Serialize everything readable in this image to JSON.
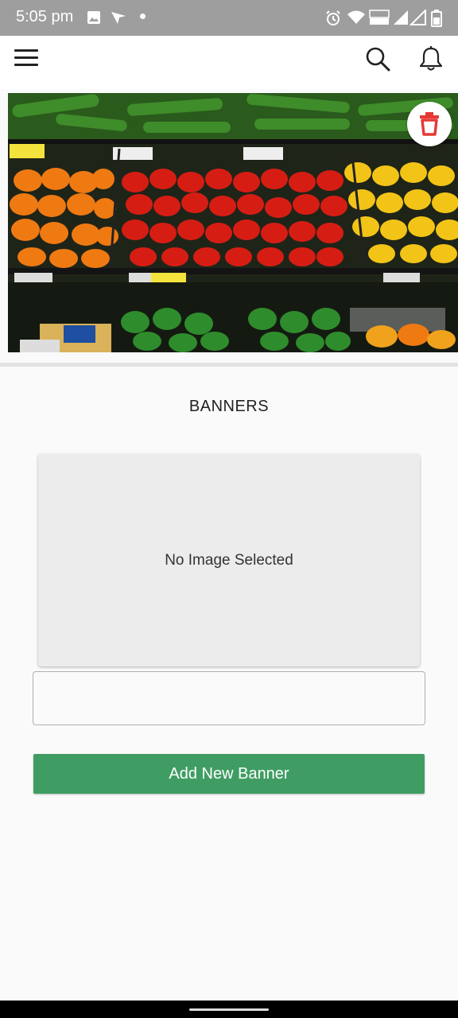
{
  "status_bar": {
    "time": "5:05 pm",
    "icons": [
      "gallery-icon",
      "maps-icon",
      "dot-icon",
      "alarm-icon",
      "wifi-icon",
      "volte-icon",
      "signal-icon",
      "signal-icon",
      "battery-icon"
    ]
  },
  "app_bar": {
    "menu_icon": "hamburger-menu-icon",
    "search_icon": "search-icon",
    "notification_icon": "bell-icon"
  },
  "banner": {
    "image": "peppers-shelf-photo",
    "price_tags": [
      "1 29",
      "2 49",
      "3 49",
      "$3"
    ],
    "delete_icon": "trash-icon"
  },
  "section": {
    "title": "BANNERS"
  },
  "image_picker": {
    "placeholder": "No Image Selected"
  },
  "banner_input": {
    "value": "",
    "placeholder": ""
  },
  "add_button": {
    "label": "Add New Banner"
  },
  "colors": {
    "accent_green": "#3f9d63",
    "delete_red": "#e53935",
    "status_bar": "#9e9e9e"
  }
}
